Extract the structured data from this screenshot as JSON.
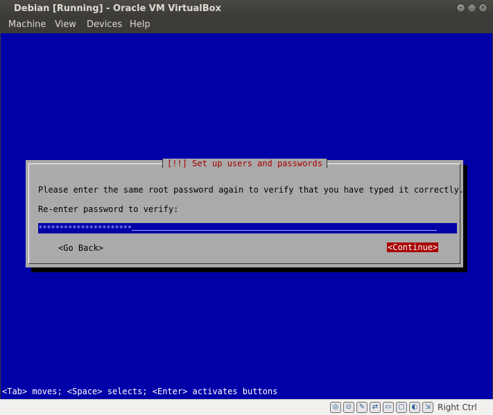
{
  "window": {
    "title": "Debian [Running] - Oracle VM VirtualBox",
    "buttons": {
      "minimize": "–",
      "maximize": "□",
      "close": "×"
    }
  },
  "menu": [
    {
      "label": "Machine"
    },
    {
      "label": "View"
    },
    {
      "label": "Devices"
    },
    {
      "label": "Help"
    }
  ],
  "installer": {
    "dialog_title": "[!!] Set up users and passwords",
    "prompt": "Please enter the same root password again to verify that you have typed it correctly.",
    "field_label": "Re-enter password to verify:",
    "password_value": "**********************",
    "go_back": "<Go Back>",
    "continue": "<Continue>",
    "hint": "<Tab> moves; <Space> selects; <Enter> activates buttons"
  },
  "statusbar": {
    "icons": [
      "hard-disk-icon",
      "optical-drive-icon",
      "usb-icon",
      "network-icon",
      "shared-folders-icon",
      "display-icon",
      "video-capture-icon",
      "mouse-integration-icon"
    ],
    "icon_glyphs": [
      "◎",
      "⊙",
      "✎",
      "⇄",
      "▭",
      "▢",
      "◐",
      "⇲"
    ],
    "host_key": "Right Ctrl"
  },
  "colors": {
    "screen_bg": "#0000a8",
    "dialog_bg": "#aaaaaa",
    "accent_red": "#a80000"
  }
}
